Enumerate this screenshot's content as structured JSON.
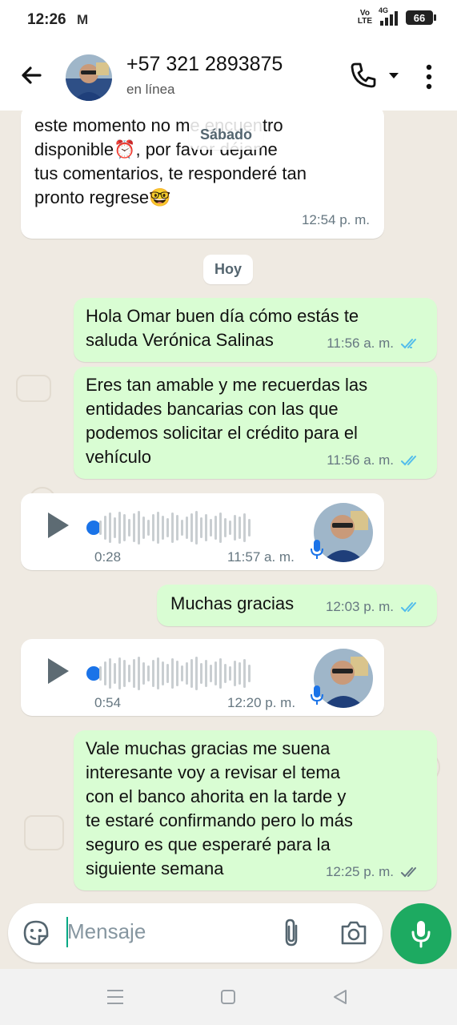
{
  "status_bar": {
    "time": "12:26",
    "app_icon": "gmail-icon",
    "volte": "Vo LTE",
    "network": "4G",
    "battery": "66"
  },
  "header": {
    "contact_name": "+57 321 2893875",
    "contact_status": "en línea"
  },
  "messages": [
    {
      "direction": "incoming",
      "text": "este momento no me encuentro\ndisponible⏰, por favor déjame\ntus comentarios, te responderé tan\npronto regrese🤓",
      "time": "12:54 p. m."
    },
    {
      "direction": "outgoing",
      "text": "Hola Omar buen día cómo estás te\nsaluda Verónica Salinas",
      "time": "11:56 a. m.",
      "status": "read"
    },
    {
      "direction": "outgoing",
      "text": "Eres tan amable y me recuerdas las\nentidades bancarias con las que\npodemos solicitar el crédito para el\nvehículo",
      "time": "11:56 a. m.",
      "status": "read"
    },
    {
      "direction": "incoming",
      "type": "voice",
      "duration": "0:28",
      "time": "11:57 a. m."
    },
    {
      "direction": "outgoing",
      "text": "Muchas gracias",
      "time": "12:03 p. m.",
      "status": "read"
    },
    {
      "direction": "incoming",
      "type": "voice",
      "duration": "0:54",
      "time": "12:20 p. m."
    },
    {
      "direction": "outgoing",
      "text": "Vale muchas gracias me suena\ninteresante voy a revisar el tema\ncon el banco ahorita en la tarde y\nte estaré confirmando pero lo más\nseguro es que esperaré para la\nsiguiente semana",
      "time": "12:25 p. m.",
      "status": "delivered"
    }
  ],
  "date_separators": {
    "sticky": "Sábado",
    "today": "Hoy"
  },
  "input": {
    "placeholder": "Mensaje"
  },
  "colors": {
    "outgoing_bubble": "#d9fdd3",
    "incoming_bubble": "#ffffff",
    "chat_background": "#efeae2",
    "read_ticks": "#53bdeb",
    "delivered_ticks": "#667781",
    "mic_button": "#1daa61"
  }
}
